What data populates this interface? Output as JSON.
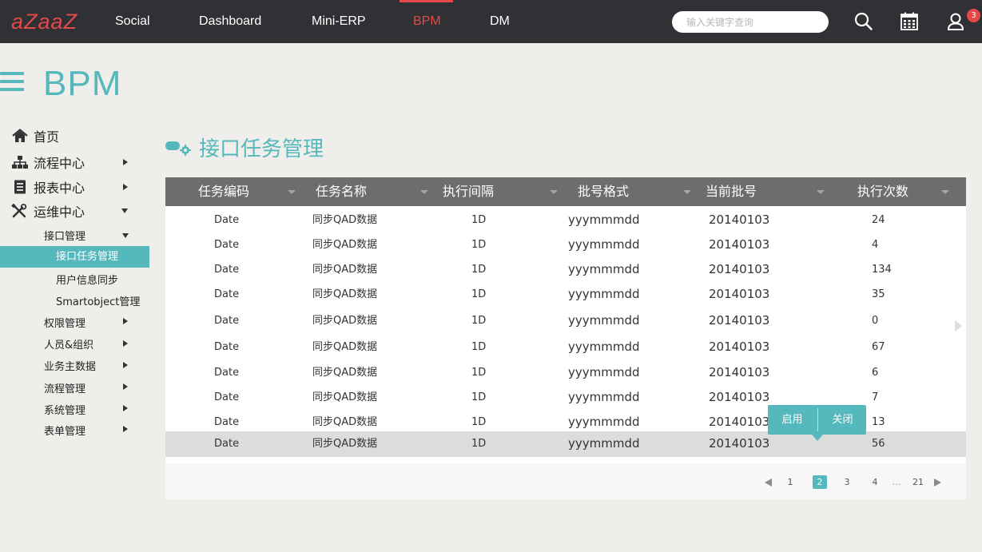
{
  "header": {
    "logo": "aZaaZ",
    "nav": [
      "Social",
      "Dashboard",
      "Mini-ERP",
      "BPM",
      "DM"
    ],
    "active_nav": "BPM",
    "search_placeholder": "输入关键字查询",
    "notification_count": "3",
    "accent_color": "#e4494a"
  },
  "sidebar": {
    "app_title": "BPM",
    "home": "首页",
    "flow_center": "流程中心",
    "report_center": "报表中心",
    "ops_center": "运维中心",
    "interface_mgmt": "接口管理",
    "interface_task_mgmt": "接口任务管理",
    "user_info_sync": "用户信息同步",
    "smartobject_mgmt": "Smartobject管理",
    "permission_mgmt": "权限管理",
    "people_org": "人员&组织",
    "master_data": "业务主数据",
    "process_mgmt": "流程管理",
    "system_mgmt": "系统管理",
    "form_mgmt": "表单管理",
    "accent_color": "#54b8bc"
  },
  "main": {
    "page_title": "接口任务管理",
    "columns": [
      "任务编码",
      "任务名称",
      "执行间隔",
      "批号格式",
      "当前批号",
      "执行次数"
    ],
    "rows": [
      {
        "code": "Date",
        "name": "同步QAD数据",
        "interval": "1D",
        "format": "yyymmmdd",
        "batch": "20140103",
        "count": "24"
      },
      {
        "code": "Date",
        "name": "同步QAD数据",
        "interval": "1D",
        "format": "yyymmmdd",
        "batch": "20140103",
        "count": "4"
      },
      {
        "code": "Date",
        "name": "同步QAD数据",
        "interval": "1D",
        "format": "yyymmmdd",
        "batch": "20140103",
        "count": "134"
      },
      {
        "code": "Date",
        "name": "同步QAD数据",
        "interval": "1D",
        "format": "yyymmmdd",
        "batch": "20140103",
        "count": "35"
      },
      {
        "code": "Date",
        "name": "同步QAD数据",
        "interval": "1D",
        "format": "yyymmmdd",
        "batch": "20140103",
        "count": "0"
      },
      {
        "code": "Date",
        "name": "同步QAD数据",
        "interval": "1D",
        "format": "yyymmmdd",
        "batch": "20140103",
        "count": "67"
      },
      {
        "code": "Date",
        "name": "同步QAD数据",
        "interval": "1D",
        "format": "yyymmmdd",
        "batch": "20140103",
        "count": "6"
      },
      {
        "code": "Date",
        "name": "同步QAD数据",
        "interval": "1D",
        "format": "yyymmmdd",
        "batch": "20140103",
        "count": "7"
      },
      {
        "code": "Date",
        "name": "同步QAD数据",
        "interval": "1D",
        "format": "yyymmmdd",
        "batch": "20140103",
        "count": "13"
      },
      {
        "code": "Date",
        "name": "同步QAD数据",
        "interval": "1D",
        "format": "yyymmmdd",
        "batch": "20140103",
        "count": "56"
      }
    ],
    "selected_row": 10,
    "pagination": {
      "pages": [
        "1",
        "2",
        "3",
        "4"
      ],
      "ellipsis": "…",
      "last": "21",
      "current": "2"
    },
    "popup": {
      "enable": "启用",
      "close": "关闭"
    }
  }
}
